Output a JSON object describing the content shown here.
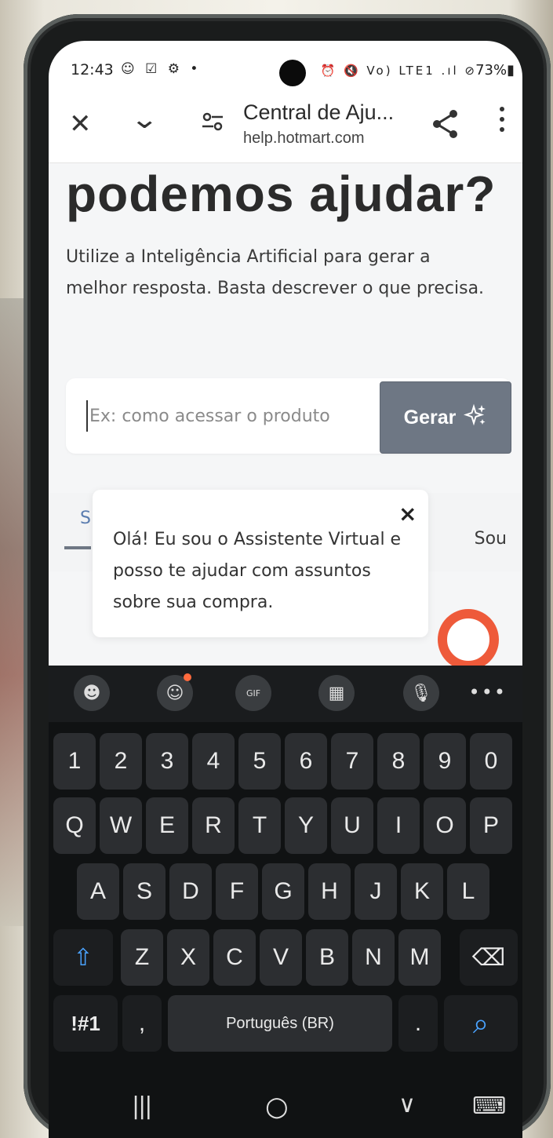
{
  "status_bar": {
    "time": "12:43",
    "left_icons": "☺ ☑ ⚙ •",
    "right_icons": "⏰ 🔇 Vo) LTE1 .ıl ⊘",
    "battery": "73%"
  },
  "browser": {
    "page_title": "Central de Aju...",
    "url": "help.hotmart.com",
    "icons": [
      "close-icon",
      "chevron-down-icon",
      "tune-icon",
      "share-icon",
      "more-vert-icon"
    ]
  },
  "page": {
    "heading": "podemos ajudar?",
    "subtitle": "Utilize a Inteligência Artificial para gerar a melhor resposta. Basta descrever o que precisa.",
    "search": {
      "placeholder": "Ex: como acessar o produto",
      "value": ""
    },
    "generate_label": "Gerar",
    "generate_icon": "sparkle-icon",
    "tab_left_fragment": "S",
    "tab_right_fragment": "Sou"
  },
  "assistant_popup": {
    "close_label": "×",
    "message": "Olá! Eu sou o Assistente Virtual e posso te ajudar com assuntos sobre sua compra."
  },
  "keyboard": {
    "toolbar": [
      "emoji-face-icon",
      "sticker-icon",
      "gif-icon",
      "clipboard-icon",
      "microphone-icon",
      "more-horiz-icon"
    ],
    "toolbar_labels": {
      "gif": "GIF",
      "more": "•••"
    },
    "row_numbers": [
      "1",
      "2",
      "3",
      "4",
      "5",
      "6",
      "7",
      "8",
      "9",
      "0"
    ],
    "row_q": [
      "Q",
      "W",
      "E",
      "R",
      "T",
      "Y",
      "U",
      "I",
      "O",
      "P"
    ],
    "row_a": [
      "A",
      "S",
      "D",
      "F",
      "G",
      "H",
      "J",
      "K",
      "L"
    ],
    "row_z": [
      "Z",
      "X",
      "C",
      "V",
      "B",
      "N",
      "M"
    ],
    "symbols_label": "!#1",
    "comma_label": ",",
    "space_label": "Português (BR)",
    "period_label": ".",
    "shift_icon": "⇧",
    "backspace_icon": "⌫",
    "search_icon": "⌕"
  },
  "nav_bar": {
    "recents": "|||",
    "home": "○",
    "back": "∨",
    "keyboard": "⌨"
  },
  "colors": {
    "generate_button": "#6e7784",
    "chat_fab": "#ee5a3a",
    "shift_accent": "#4aa3ff",
    "search_accent": "#4aa3ff",
    "keyboard_bg": "#101213"
  }
}
